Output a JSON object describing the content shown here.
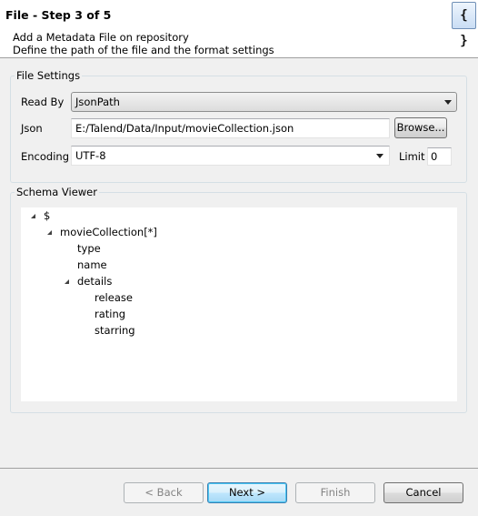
{
  "header": {
    "title": "File - Step 3 of 5",
    "description_line1": "Add a Metadata File on repository",
    "description_line2": "Define the path of the file and the format settings",
    "icon": "json-braces-icon",
    "icon_glyph": "{ }"
  },
  "file_settings": {
    "legend": "File Settings",
    "read_by_label": "Read By",
    "read_by_value": "JsonPath",
    "json_label": "Json",
    "json_path": "E:/Talend/Data/Input/movieCollection.json",
    "browse_label": "Browse...",
    "encoding_label": "Encoding",
    "encoding_value": "UTF-8",
    "limit_label": "Limit",
    "limit_value": "0"
  },
  "schema_viewer": {
    "legend": "Schema Viewer",
    "nodes": [
      {
        "label": "$",
        "expanded": true
      },
      {
        "label": "movieCollection[*]",
        "expanded": true
      },
      {
        "label": "type"
      },
      {
        "label": "name"
      },
      {
        "label": "details",
        "expanded": true
      },
      {
        "label": "release"
      },
      {
        "label": "rating"
      },
      {
        "label": "starring"
      }
    ]
  },
  "buttons": {
    "back": "< Back",
    "next": "Next >",
    "finish": "Finish",
    "cancel": "Cancel"
  }
}
